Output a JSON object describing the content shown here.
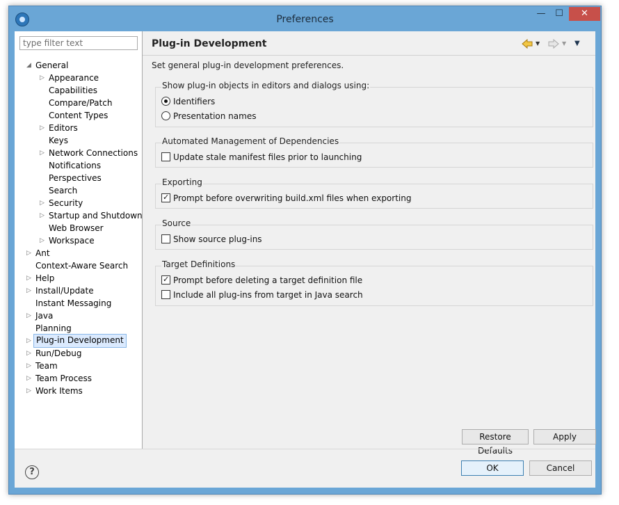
{
  "window": {
    "title": "Preferences",
    "minimize": "—",
    "maximize": "☐",
    "close": "✕"
  },
  "filter": {
    "placeholder": "type filter text"
  },
  "tree": [
    {
      "label": "General",
      "expanded": true
    },
    {
      "label": "Appearance",
      "has_children": true
    },
    {
      "label": "Capabilities"
    },
    {
      "label": "Compare/Patch"
    },
    {
      "label": "Content Types"
    },
    {
      "label": "Editors",
      "has_children": true
    },
    {
      "label": "Keys"
    },
    {
      "label": "Network Connections",
      "has_children": true
    },
    {
      "label": "Notifications"
    },
    {
      "label": "Perspectives"
    },
    {
      "label": "Search"
    },
    {
      "label": "Security",
      "has_children": true
    },
    {
      "label": "Startup and Shutdown",
      "has_children": true
    },
    {
      "label": "Web Browser"
    },
    {
      "label": "Workspace",
      "has_children": true
    },
    {
      "label": "Ant",
      "has_children": true
    },
    {
      "label": "Context-Aware Search"
    },
    {
      "label": "Help",
      "has_children": true
    },
    {
      "label": "Install/Update",
      "has_children": true
    },
    {
      "label": "Instant Messaging"
    },
    {
      "label": "Java",
      "has_children": true
    },
    {
      "label": "Planning"
    },
    {
      "label": "Plug-in Development",
      "has_children": true,
      "selected": true
    },
    {
      "label": "Run/Debug",
      "has_children": true
    },
    {
      "label": "Team",
      "has_children": true
    },
    {
      "label": "Team Process",
      "has_children": true
    },
    {
      "label": "Work Items",
      "has_children": true
    }
  ],
  "page": {
    "title": "Plug-in Development",
    "description": "Set general plug-in development preferences.",
    "show_objects": {
      "title": "Show plug-in objects in editors and dialogs using:",
      "identifiers": "Identifiers",
      "identifiers_selected": true,
      "presentation": "Presentation names",
      "presentation_selected": false
    },
    "dependencies": {
      "title": "Automated Management of Dependencies",
      "update_stale": "Update stale manifest files prior to launching",
      "update_stale_checked": false
    },
    "exporting": {
      "title": "Exporting",
      "prompt_overwrite": "Prompt before overwriting build.xml files when exporting",
      "prompt_overwrite_checked": true
    },
    "source": {
      "title": "Source",
      "show_source": "Show source plug-ins",
      "show_source_checked": false
    },
    "target": {
      "title": "Target Definitions",
      "prompt_delete": "Prompt before deleting a target definition file",
      "prompt_delete_checked": true,
      "include_all": "Include all plug-ins from target in Java search",
      "include_all_checked": false
    }
  },
  "nav_icons": [
    "back-arrow-icon",
    "forward-arrow-icon",
    "view-menu-icon"
  ],
  "buttons": {
    "restore_defaults": "Restore Defaults",
    "apply": "Apply",
    "ok": "OK",
    "cancel": "Cancel",
    "help": "?"
  },
  "colors": {
    "window_frame": "#6aa6d6",
    "close_button": "#c7504a",
    "selection": "#dbeafe"
  }
}
